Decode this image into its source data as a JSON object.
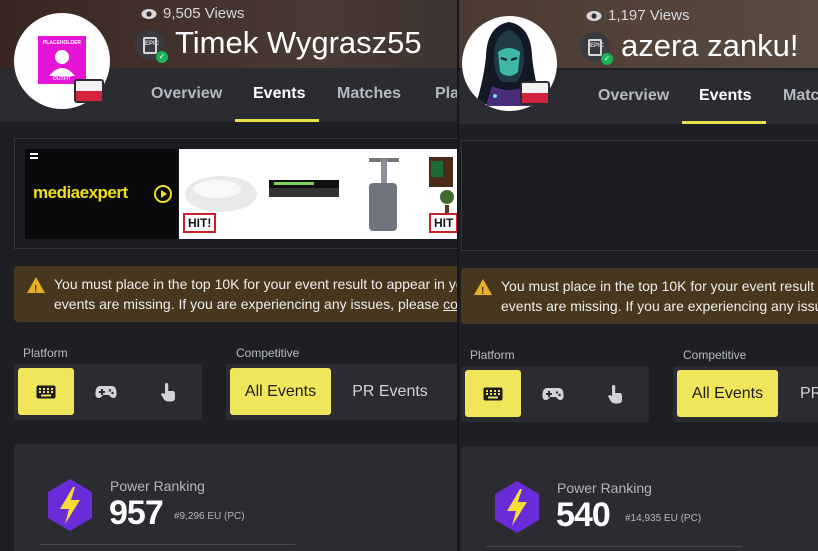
{
  "colors": {
    "accent": "#f0e65c",
    "warning_bg": "#47371e",
    "warning_icon": "#e9b026",
    "verified": "#1ab35a",
    "power_hex": "#6a2bd8",
    "power_bolt": "#f4dd36"
  },
  "left": {
    "views": "9,505 Views",
    "player_name": "Timek Wygrasz55",
    "avatar_icon": "placeholder-outfit",
    "avatar_text_top": "PLACEHOLDER",
    "avatar_text_bottom": "OUTFIT",
    "country_flag": "poland",
    "tabs": [
      "Overview",
      "Events",
      "Matches",
      "Pla"
    ],
    "active_tab": "Events",
    "ad": {
      "brand": "mediaexpert",
      "badge1": "HIT!",
      "badge2": "HIT"
    },
    "warning": {
      "line1": "You must place in the top 10K for your event result to appear in yo",
      "line2_prefix": "events are missing. If you are experiencing any issues, please ",
      "line2_link": "con"
    },
    "platform_label": "Platform",
    "competitive_label": "Competitive",
    "platform_buttons": [
      "keyboard-icon",
      "gamepad-icon",
      "touch-icon"
    ],
    "competitive_buttons": [
      "All Events",
      "PR Events"
    ],
    "power_ranking_label": "Power Ranking",
    "power_ranking_value": "957",
    "power_ranking_rank": "#9,296 EU (PC)"
  },
  "right": {
    "views": "1,197 Views",
    "player_name": "azera zanku!",
    "avatar_icon": "hooded-character",
    "country_flag": "poland",
    "tabs": [
      "Overview",
      "Events",
      "Matc"
    ],
    "active_tab": "Events",
    "warning": {
      "line1": "You must place in the top 10K for your event result t",
      "line2": "events are missing. If you are experiencing any issu"
    },
    "platform_label": "Platform",
    "competitive_label": "Competitive",
    "platform_buttons": [
      "keyboard-icon",
      "gamepad-icon",
      "touch-icon"
    ],
    "competitive_buttons": [
      "All Events",
      "PR"
    ],
    "power_ranking_label": "Power Ranking",
    "power_ranking_value": "540",
    "power_ranking_rank": "#14,935 EU (PC)"
  }
}
